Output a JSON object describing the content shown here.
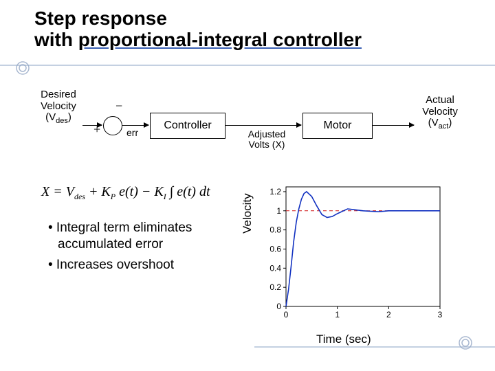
{
  "title_line1": "Step response",
  "title_line2_a": "with ",
  "title_line2_b": "proportional-integral controller",
  "diagram": {
    "desired_label_l1": "Desired",
    "desired_label_l2": "Velocity",
    "desired_symbol_pre": "(V",
    "desired_symbol_sub": "des",
    "desired_symbol_post": ")",
    "plus": "+",
    "minus": "−",
    "err": "err",
    "controller": "Controller",
    "adjusted_l1": "Adjusted",
    "adjusted_l2": "Volts (X)",
    "motor": "Motor",
    "actual_label_l1": "Actual",
    "actual_label_l2": "Velocity",
    "actual_symbol_pre": "(V",
    "actual_symbol_sub": "act",
    "actual_symbol_post": ")"
  },
  "equation": {
    "text_parts": [
      "X = V",
      "des",
      " + K",
      "P",
      " e(t) − K",
      "I",
      " ∫ e(t) dt"
    ]
  },
  "bullets": {
    "b1": "• Integral term eliminates accumulated error",
    "b2": "• Increases overshoot"
  },
  "chart_labels": {
    "ylabel": "Velocity",
    "xlabel": "Time (sec)"
  },
  "chart_data": {
    "type": "line",
    "xlabel": "Time (sec)",
    "ylabel": "Velocity",
    "xlim": [
      0,
      3
    ],
    "ylim": [
      0,
      1.25
    ],
    "xticks": [
      0,
      1,
      2,
      3
    ],
    "yticks": [
      0,
      0.2,
      0.4,
      0.6,
      0.8,
      1,
      1.2
    ],
    "reference_line": 1.0,
    "series": [
      {
        "name": "Velocity step response (PI)",
        "color": "#1030c0",
        "x": [
          0,
          0.05,
          0.1,
          0.15,
          0.2,
          0.25,
          0.3,
          0.35,
          0.4,
          0.5,
          0.6,
          0.7,
          0.8,
          0.9,
          1.0,
          1.2,
          1.5,
          1.8,
          2.0,
          2.5,
          3.0
        ],
        "y": [
          0,
          0.18,
          0.42,
          0.68,
          0.88,
          1.02,
          1.12,
          1.18,
          1.2,
          1.15,
          1.05,
          0.96,
          0.93,
          0.94,
          0.97,
          1.02,
          1.0,
          0.99,
          1.0,
          1.0,
          1.0
        ]
      }
    ]
  }
}
